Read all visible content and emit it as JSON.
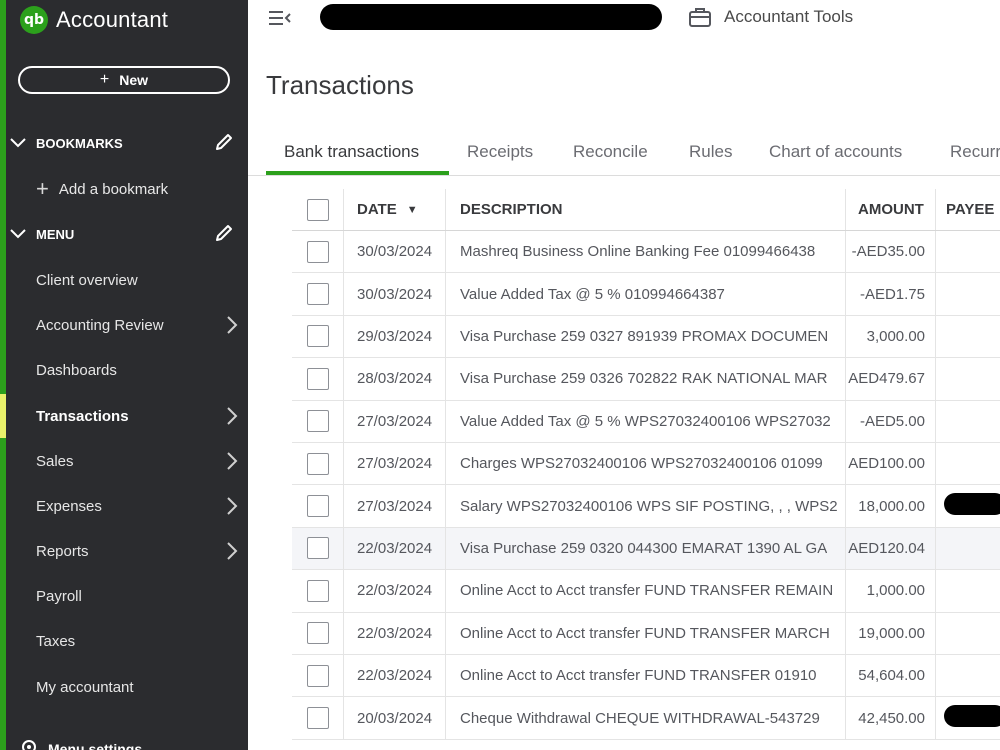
{
  "brand": {
    "logo": "qb",
    "name": "Accountant"
  },
  "sidebar": {
    "new_label": "New",
    "bookmarks_label": "BOOKMARKS",
    "add_bookmark": "Add a bookmark",
    "menu_label": "MENU",
    "items": [
      {
        "label": "Client overview",
        "has_arrow": false
      },
      {
        "label": "Accounting Review",
        "has_arrow": true
      },
      {
        "label": "Dashboards",
        "has_arrow": false
      },
      {
        "label": "Transactions",
        "has_arrow": true,
        "active": true
      },
      {
        "label": "Sales",
        "has_arrow": true
      },
      {
        "label": "Expenses",
        "has_arrow": true
      },
      {
        "label": "Reports",
        "has_arrow": true
      },
      {
        "label": "Payroll",
        "has_arrow": false
      },
      {
        "label": "Taxes",
        "has_arrow": false
      },
      {
        "label": "My accountant",
        "has_arrow": false
      }
    ],
    "menu_settings": "Menu settings"
  },
  "topbar": {
    "tools_label": "Accountant Tools"
  },
  "page": {
    "title": "Transactions"
  },
  "tabs": [
    {
      "label": "Bank transactions",
      "active": true
    },
    {
      "label": "Receipts"
    },
    {
      "label": "Reconcile"
    },
    {
      "label": "Rules"
    },
    {
      "label": "Chart of accounts"
    },
    {
      "label": "Recurri"
    }
  ],
  "table": {
    "headers": {
      "date": "DATE",
      "description": "DESCRIPTION",
      "amount": "AMOUNT",
      "payee": "PAYEE"
    },
    "rows": [
      {
        "date": "30/03/2024",
        "description": "Mashreq Business Online Banking Fee 01099466438",
        "amount": "-AED35.00"
      },
      {
        "date": "30/03/2024",
        "description": "Value Added Tax @ 5 % 010994664387",
        "amount": "-AED1.75"
      },
      {
        "date": "29/03/2024",
        "description": "Visa Purchase 259 0327 891939 PROMAX DOCUMEN",
        "amount": "3,000.00"
      },
      {
        "date": "28/03/2024",
        "description": "Visa Purchase 259 0326 702822 RAK NATIONAL MAR",
        "amount": "AED479.67"
      },
      {
        "date": "27/03/2024",
        "description": "Value Added Tax @ 5 % WPS27032400106 WPS27032",
        "amount": "-AED5.00"
      },
      {
        "date": "27/03/2024",
        "description": "Charges WPS27032400106 WPS27032400106 01099",
        "amount": "AED100.00"
      },
      {
        "date": "27/03/2024",
        "description": "Salary WPS27032400106 WPS SIF POSTING, , , WPS2",
        "amount": "18,000.00",
        "payee_redacted": true
      },
      {
        "date": "22/03/2024",
        "description": "Visa Purchase 259 0320 044300 EMARAT 1390 AL GA",
        "amount": "AED120.04",
        "highlighted": true
      },
      {
        "date": "22/03/2024",
        "description": "Online Acct to Acct transfer FUND TRANSFER REMAIN",
        "amount": "1,000.00"
      },
      {
        "date": "22/03/2024",
        "description": "Online Acct to Acct transfer FUND TRANSFER MARCH",
        "amount": "19,000.00"
      },
      {
        "date": "22/03/2024",
        "description": "Online Acct to Acct transfer FUND TRANSFER 01910",
        "amount": "54,604.00"
      },
      {
        "date": "20/03/2024",
        "description": "Cheque Withdrawal CHEQUE WITHDRAWAL-543729",
        "amount": "42,450.00",
        "payee_redacted": true
      }
    ]
  },
  "colors": {
    "sidebar_bg": "#2b2c2f",
    "brand_green": "#2ca01c",
    "active_marker": "#e9f26b",
    "redaction": "#000000"
  },
  "icons": [
    "qb-logo-icon",
    "plus-icon",
    "chevron-down-icon",
    "pencil-icon",
    "chevron-right-icon",
    "hamburger-menu-icon",
    "briefcase-icon",
    "sort-down-icon",
    "gear-icon"
  ]
}
